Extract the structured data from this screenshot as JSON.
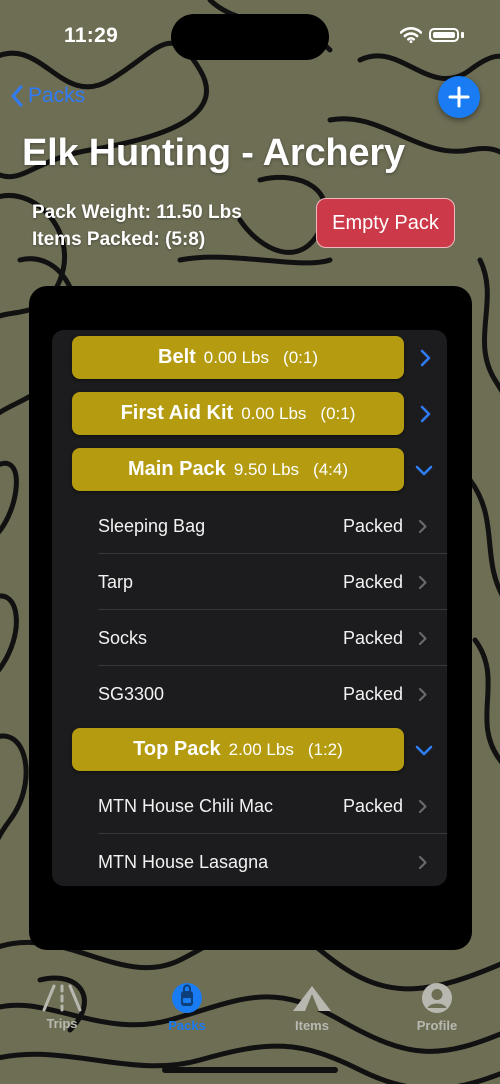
{
  "status_bar": {
    "time": "11:29"
  },
  "nav": {
    "back_label": "Packs"
  },
  "pack": {
    "title": "Elk Hunting - Archery",
    "weight_text": "Pack Weight: 11.50 Lbs",
    "items_text": "Items Packed: (5:8)",
    "empty_button": "Empty Pack"
  },
  "groups": [
    {
      "name": "Belt",
      "weight": "0.00 Lbs",
      "count": "(0:1)",
      "expanded": false,
      "items": []
    },
    {
      "name": "First Aid Kit",
      "weight": "0.00 Lbs",
      "count": "(0:1)",
      "expanded": false,
      "items": []
    },
    {
      "name": "Main Pack",
      "weight": "9.50 Lbs",
      "count": "(4:4)",
      "expanded": true,
      "items": [
        {
          "name": "Sleeping Bag",
          "status": "Packed"
        },
        {
          "name": "Tarp",
          "status": "Packed"
        },
        {
          "name": "Socks",
          "status": "Packed"
        },
        {
          "name": "SG3300",
          "status": "Packed"
        }
      ]
    },
    {
      "name": "Top Pack",
      "weight": "2.00 Lbs",
      "count": "(1:2)",
      "expanded": true,
      "items": [
        {
          "name": "MTN House Chili Mac",
          "status": "Packed"
        },
        {
          "name": "MTN House Lasagna",
          "status": ""
        }
      ]
    }
  ],
  "tabs": [
    {
      "label": "Trips",
      "icon": "trips-icon",
      "active": false
    },
    {
      "label": "Packs",
      "icon": "backpack-icon",
      "active": true
    },
    {
      "label": "Items",
      "icon": "tent-icon",
      "active": false
    },
    {
      "label": "Profile",
      "icon": "person-icon",
      "active": false
    }
  ],
  "colors": {
    "accent": "#1a7cf3",
    "group_pill": "#b49b10",
    "empty_button": "#cc3a4a",
    "list_background": "#1c1c1e",
    "topo_background": "#6e6e55"
  }
}
